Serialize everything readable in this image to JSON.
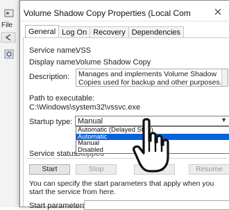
{
  "background_window": {
    "menu_label": "File"
  },
  "dialog": {
    "title": "Volume Shadow Copy Properties (Local Computer)",
    "tabs": [
      {
        "label": "General",
        "active": true
      },
      {
        "label": "Log On",
        "active": false
      },
      {
        "label": "Recovery",
        "active": false
      },
      {
        "label": "Dependencies",
        "active": false
      }
    ],
    "general": {
      "service_name_label": "Service name:",
      "service_name": "VSS",
      "display_name_label": "Display name:",
      "display_name": "Volume Shadow Copy",
      "description_label": "Description:",
      "description": "Manages and implements Volume Shadow Copies used for backup and other purposes. If this service",
      "path_label": "Path to executable:",
      "path": "C:\\Windows\\system32\\vssvc.exe",
      "startup_type_label": "Startup type:",
      "startup_type_value": "Manual",
      "startup_options": [
        {
          "label": "Automatic (Delayed Start)",
          "highlighted": false
        },
        {
          "label": "Automatic",
          "highlighted": true
        },
        {
          "label": "Manual",
          "highlighted": false
        },
        {
          "label": "Disabled",
          "highlighted": false
        }
      ],
      "service_status_label": "Service status:",
      "service_status": "Stopped",
      "buttons": {
        "start": "Start",
        "stop": "Stop",
        "pause": "Pause",
        "resume": "Resume"
      },
      "note": "You can specify the start parameters that apply when you start the service from here.",
      "start_parameters_label": "Start parameters:"
    }
  },
  "colors": {
    "highlight": "#0a64d8",
    "dialog_bg": "#ffffff",
    "border": "#a9a9a9"
  }
}
